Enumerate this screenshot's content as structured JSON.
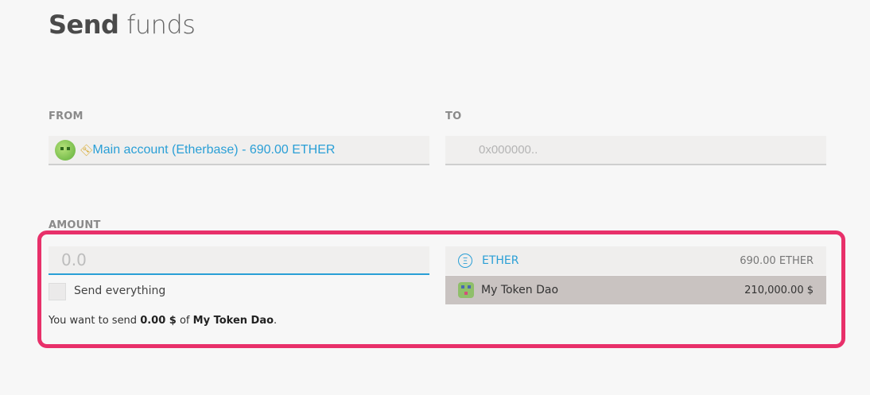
{
  "page": {
    "title_bold": "Send",
    "title_rest": " funds"
  },
  "from": {
    "label": "FROM",
    "account_text": "Main account (Etherbase) - 690.00 ETHER"
  },
  "to": {
    "label": "TO",
    "placeholder": "0x000000.."
  },
  "amount": {
    "label": "AMOUNT",
    "placeholder": "0.0",
    "send_everything_label": "Send everything",
    "summary_prefix": "You want to send ",
    "summary_amount": "0.00 $",
    "summary_of": " of ",
    "summary_token": "My Token Dao",
    "summary_suffix": "."
  },
  "tokens": [
    {
      "name": "ETHER",
      "balance": "690.00 ETHER",
      "icon": "ether-icon",
      "selected": false
    },
    {
      "name": "My Token Dao",
      "balance": "210,000.00 $",
      "icon": "token-identicon",
      "selected": true
    }
  ],
  "colors": {
    "accent": "#2a9fd6",
    "highlight": "#e8306a"
  }
}
